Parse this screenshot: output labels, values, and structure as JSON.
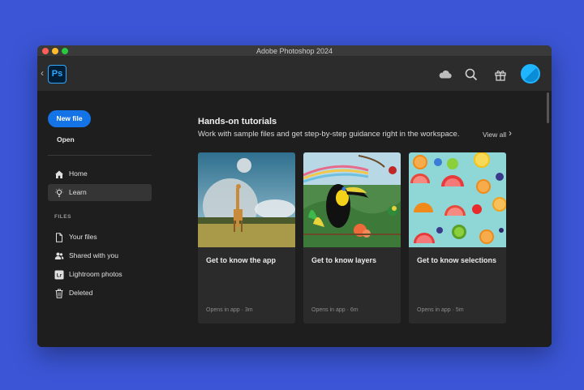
{
  "window": {
    "title": "Adobe Photoshop 2024"
  },
  "appbar": {
    "logo_text": "Ps",
    "icons": [
      "cloud-icon",
      "search-icon",
      "gift-icon"
    ]
  },
  "sidebar": {
    "new_file_label": "New file",
    "open_label": "Open",
    "nav": [
      {
        "label": "Home",
        "icon": "home-icon",
        "active": false
      },
      {
        "label": "Learn",
        "icon": "lightbulb-icon",
        "active": true
      }
    ],
    "files_heading": "FILES",
    "files": [
      {
        "label": "Your files",
        "icon": "document-icon"
      },
      {
        "label": "Shared with you",
        "icon": "shared-users-icon"
      },
      {
        "label": "Lightroom photos",
        "icon": "lightroom-icon"
      },
      {
        "label": "Deleted",
        "icon": "trash-icon"
      }
    ]
  },
  "main": {
    "section_title": "Hands-on tutorials",
    "section_subtitle": "Work with sample files and get step-by-step guidance right in the workspace.",
    "view_all_label": "View all",
    "cards": [
      {
        "title": "Get to know the app",
        "meta": "Opens in app  ·  3m"
      },
      {
        "title": "Get to know layers",
        "meta": "Opens in app  ·  6m"
      },
      {
        "title": "Get to know selections",
        "meta": "Opens in app  ·  5m"
      }
    ]
  },
  "colors": {
    "accent": "#1473e6",
    "background": "#3b55d6",
    "ps_blue": "#31a8ff"
  }
}
